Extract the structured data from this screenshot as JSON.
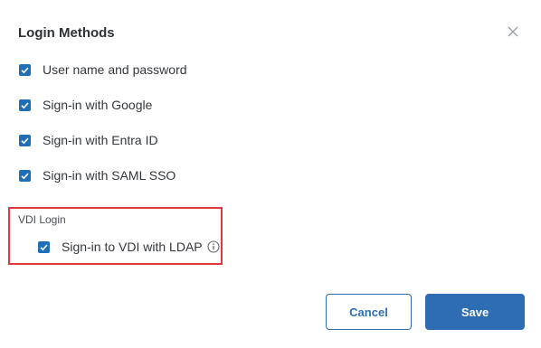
{
  "dialog": {
    "title": "Login Methods",
    "close_icon": "close-icon"
  },
  "options": [
    {
      "label": "User name and password",
      "checked": true
    },
    {
      "label": "Sign-in with Google",
      "checked": true
    },
    {
      "label": "Sign-in with Entra ID",
      "checked": true
    },
    {
      "label": "Sign-in with SAML SSO",
      "checked": true
    }
  ],
  "vdi": {
    "section_title": "VDI Login",
    "option": {
      "label": "Sign-in to VDI with LDAP",
      "checked": true
    },
    "info_icon": "info-icon",
    "highlight_color": "#e0383e"
  },
  "footer": {
    "cancel_label": "Cancel",
    "save_label": "Save"
  },
  "colors": {
    "accent": "#2e6db3",
    "checkbox": "#1e6fb7"
  }
}
